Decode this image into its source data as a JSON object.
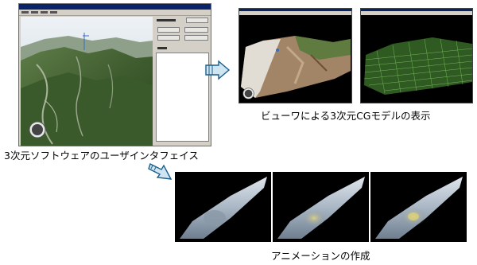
{
  "captions": {
    "main_ui": "3次元ソフトウェアのユーザインタフェイス",
    "viewer": "ビューワによる3次元CGモデルの表示",
    "animation": "アニメーションの作成"
  },
  "colors": {
    "arrow_fill": "#cfe6f2",
    "arrow_stroke": "#1a5f8a",
    "window_chrome": "#d4d0c8",
    "title_bar": "#0a246a",
    "frame_background": "#000000"
  },
  "icons": [
    "compass-icon",
    "arrow-right-icon",
    "arrow-down-right-icon"
  ]
}
